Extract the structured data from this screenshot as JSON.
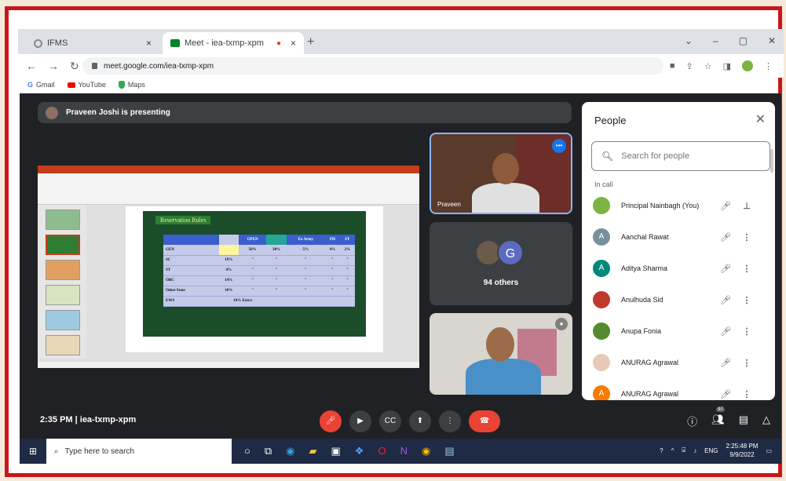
{
  "browser": {
    "tabs": [
      {
        "label": "IFMS",
        "close": "×"
      },
      {
        "label": "Meet - iea-txmp-xpm",
        "close": "×"
      }
    ],
    "new_tab": "+",
    "window_controls": [
      "⌄",
      "–",
      "▢",
      "✕"
    ],
    "url": "meet.google.com/iea-txmp-xpm",
    "bookmarks": [
      "Gmail",
      "YouTube",
      "Maps"
    ]
  },
  "meet": {
    "presenting_text": "Praveen Joshi is presenting",
    "slide": {
      "title": "Reservation Rules",
      "table_header": [
        "",
        "",
        "OPEN",
        "",
        "Ex Army",
        "PH",
        "FF"
      ],
      "rows": [
        [
          "GEN",
          "",
          "50%",
          "30%",
          "5%",
          "4%",
          "2%"
        ],
        [
          "SC",
          "19%",
          "\"",
          "\"",
          "\"",
          "\"",
          "\""
        ],
        [
          "ST",
          "4%",
          "\"",
          "\"",
          "\"",
          "\"",
          "\""
        ],
        [
          "OBC",
          "14%",
          "\"",
          "\"",
          "\"",
          "\"",
          "\""
        ],
        [
          "Other State",
          "10%",
          "\"",
          "\"",
          "\"",
          "\"",
          "\""
        ],
        [
          "EWS",
          "10% Extra",
          "",
          "",
          "",
          "",
          ""
        ]
      ]
    },
    "tiles": {
      "speaker_name": "Praveen",
      "others_count": "94 others",
      "others_initial": "G"
    },
    "time_code": "2:35 PM  |  iea-txmp-xpm",
    "participant_count": "97"
  },
  "people_panel": {
    "title": "People",
    "search_placeholder": "Search for people",
    "section": "In call",
    "participants": [
      {
        "name": "Principal Nainbagh (You)",
        "initial": "",
        "color": "#7cb342",
        "action": "pin"
      },
      {
        "name": "Aanchal Rawat",
        "initial": "A",
        "color": "#78909c",
        "action": "more"
      },
      {
        "name": "Aditya Sharma",
        "initial": "A",
        "color": "#00897b",
        "action": "more"
      },
      {
        "name": "Anulhuda Sid",
        "initial": "",
        "color": "#c0392b",
        "action": "more"
      },
      {
        "name": "Anupa Fonia",
        "initial": "",
        "color": "#558b2f",
        "action": "more"
      },
      {
        "name": "ANURAG Agrawal",
        "initial": "",
        "color": "#e8c9b8",
        "action": "more"
      },
      {
        "name": "ANURAG Agrawal",
        "initial": "A",
        "color": "#f57c00",
        "action": "more"
      }
    ]
  },
  "taskbar": {
    "search_placeholder": "Type here to search",
    "lang": "ENG",
    "time": "2:25:48 PM",
    "date": "9/9/2022"
  }
}
